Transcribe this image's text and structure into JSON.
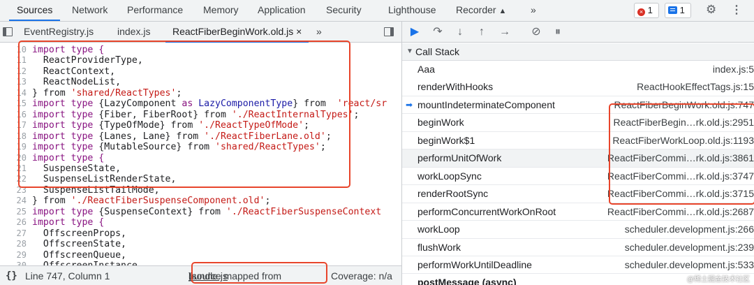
{
  "top_tabs": [
    "Sources",
    "Network",
    "Performance",
    "Memory",
    "Application",
    "Security",
    "Lighthouse",
    "Recorder"
  ],
  "top_more": "»",
  "errors_count": "1",
  "messages_count": "1",
  "file_tabs": [
    "EventRegistry.js",
    "index.js",
    "ReactFiberBeginWork.old.js"
  ],
  "file_tab_close": "×",
  "file_tabs_more": "»",
  "code_lines": [
    {
      "n": "10",
      "segs": [
        {
          "t": "import type {",
          "c": "kw"
        }
      ]
    },
    {
      "n": "11",
      "segs": [
        {
          "t": "  ReactProviderType,",
          "c": ""
        }
      ]
    },
    {
      "n": "12",
      "segs": [
        {
          "t": "  ReactContext,",
          "c": ""
        }
      ]
    },
    {
      "n": "13",
      "segs": [
        {
          "t": "  ReactNodeList,",
          "c": ""
        }
      ]
    },
    {
      "n": "14",
      "segs": [
        {
          "t": "} from ",
          "c": ""
        },
        {
          "t": "'shared/ReactTypes'",
          "c": "str"
        },
        {
          "t": ";",
          "c": ""
        }
      ]
    },
    {
      "n": "15",
      "segs": [
        {
          "t": "import type ",
          "c": "kw"
        },
        {
          "t": "{LazyComponent ",
          "c": ""
        },
        {
          "t": "as",
          "c": "kw"
        },
        {
          "t": " LazyComponentType",
          "c": "type"
        },
        {
          "t": "} from  ",
          "c": ""
        },
        {
          "t": "'react/sr",
          "c": "str"
        }
      ]
    },
    {
      "n": "16",
      "segs": [
        {
          "t": "import type ",
          "c": "kw"
        },
        {
          "t": "{Fiber, FiberRoot} from ",
          "c": ""
        },
        {
          "t": "'./ReactInternalTypes'",
          "c": "str"
        },
        {
          "t": ";",
          "c": ""
        }
      ]
    },
    {
      "n": "17",
      "segs": [
        {
          "t": "import type ",
          "c": "kw"
        },
        {
          "t": "{TypeOfMode} from ",
          "c": ""
        },
        {
          "t": "'./ReactTypeOfMode'",
          "c": "str"
        },
        {
          "t": ";",
          "c": ""
        }
      ]
    },
    {
      "n": "18",
      "segs": [
        {
          "t": "import type ",
          "c": "kw"
        },
        {
          "t": "{Lanes, Lane} from ",
          "c": ""
        },
        {
          "t": "'./ReactFiberLane.old'",
          "c": "str"
        },
        {
          "t": ";",
          "c": ""
        }
      ]
    },
    {
      "n": "19",
      "segs": [
        {
          "t": "import type ",
          "c": "kw"
        },
        {
          "t": "{MutableSource} from ",
          "c": ""
        },
        {
          "t": "'shared/ReactTypes'",
          "c": "str"
        },
        {
          "t": ";",
          "c": ""
        }
      ]
    },
    {
      "n": "20",
      "segs": [
        {
          "t": "import type {",
          "c": "kw"
        }
      ]
    },
    {
      "n": "21",
      "segs": [
        {
          "t": "  SuspenseState,",
          "c": ""
        }
      ]
    },
    {
      "n": "22",
      "segs": [
        {
          "t": "  SuspenseListRenderState,",
          "c": ""
        }
      ]
    },
    {
      "n": "23",
      "segs": [
        {
          "t": "  SuspenseListTailMode,",
          "c": ""
        }
      ]
    },
    {
      "n": "24",
      "segs": [
        {
          "t": "} from ",
          "c": ""
        },
        {
          "t": "'./ReactFiberSuspenseComponent.old'",
          "c": "str"
        },
        {
          "t": ";",
          "c": ""
        }
      ]
    },
    {
      "n": "25",
      "segs": [
        {
          "t": "import type ",
          "c": "kw"
        },
        {
          "t": "{SuspenseContext} from ",
          "c": ""
        },
        {
          "t": "'./ReactFiberSuspenseContext",
          "c": "str"
        }
      ]
    },
    {
      "n": "26",
      "segs": [
        {
          "t": "import type {",
          "c": "kw"
        }
      ]
    },
    {
      "n": "27",
      "segs": [
        {
          "t": "  OffscreenProps,",
          "c": ""
        }
      ]
    },
    {
      "n": "28",
      "segs": [
        {
          "t": "  OffscreenState,",
          "c": ""
        }
      ]
    },
    {
      "n": "29",
      "segs": [
        {
          "t": "  OffscreenQueue,",
          "c": ""
        }
      ]
    },
    {
      "n": "30",
      "segs": [
        {
          "t": "  OffscreenInstance,",
          "c": ""
        }
      ]
    }
  ],
  "status": {
    "brace": "{}",
    "position": "Line 747, Column 1",
    "mapped_prefix": "(source mapped from ",
    "mapped_file": "bundle.js",
    "mapped_suffix": ")",
    "coverage": "Coverage: n/a"
  },
  "call_stack_title": "Call Stack",
  "frames": [
    {
      "name": "Aaa",
      "loc": "index.js:5"
    },
    {
      "name": "renderWithHooks",
      "loc": "ReactHookEffectTags.js:15"
    },
    {
      "name": "mountIndeterminateComponent",
      "loc": "ReactFiberBeginWork.old.js:747"
    },
    {
      "name": "beginWork",
      "loc": "ReactFiberBegin…rk.old.js:2951"
    },
    {
      "name": "beginWork$1",
      "loc": "ReactFiberWorkLoop.old.js:1193"
    },
    {
      "name": "performUnitOfWork",
      "loc": "ReactFiberCommi…rk.old.js:3861"
    },
    {
      "name": "workLoopSync",
      "loc": "ReactFiberCommi…rk.old.js:3747"
    },
    {
      "name": "renderRootSync",
      "loc": "ReactFiberCommi…rk.old.js:3715"
    },
    {
      "name": "performConcurrentWorkOnRoot",
      "loc": "ReactFiberCommi…rk.old.js:2687"
    },
    {
      "name": "workLoop",
      "loc": "scheduler.development.js:266"
    },
    {
      "name": "flushWork",
      "loc": "scheduler.development.js:239"
    },
    {
      "name": "performWorkUntilDeadline",
      "loc": "scheduler.development.js:533"
    },
    {
      "name": "postMessage (async)",
      "loc": ""
    }
  ],
  "watermark": "@稀土掘金技术社区",
  "colors": {
    "accent": "#1a73e8",
    "highlight": "#e8452b",
    "string": "#c41a16",
    "keyword": "#881280"
  }
}
